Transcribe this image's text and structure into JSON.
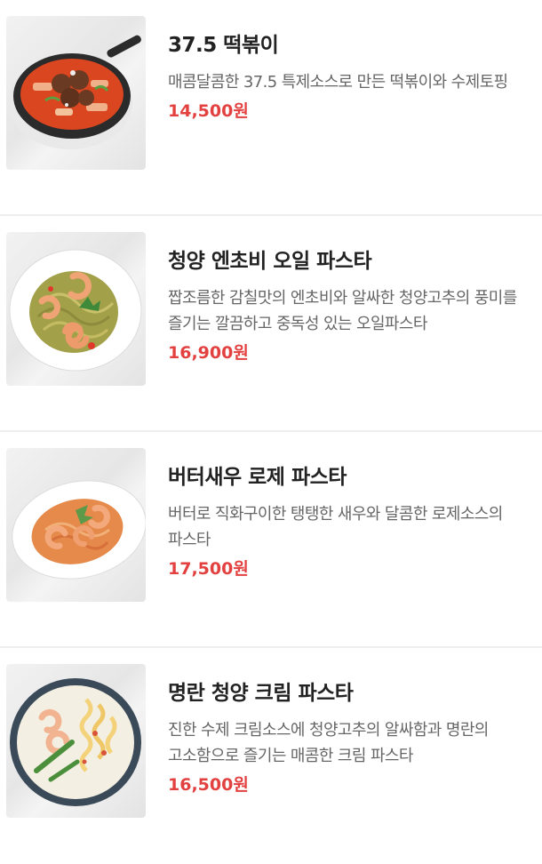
{
  "menu": {
    "items": [
      {
        "name": "37.5 떡볶이",
        "description": "매콤달콤한 37.5 특제소스로 만든 떡볶이와 수제토핑",
        "price": "14,500원",
        "image_icon": "tteokbokki-photo"
      },
      {
        "name": "청양 엔초비 오일 파스타",
        "description": "짭조름한 감칠맛의 엔초비와 알싸한 청양고추의 풍미를 즐기는 깔끔하고 중독성 있는 오일파스타",
        "price": "16,900원",
        "image_icon": "anchovy-oil-pasta-photo"
      },
      {
        "name": "버터새우 로제 파스타",
        "description": "버터로 직화구이한 탱탱한 새우와 달콤한 로제소스의 파스타",
        "price": "17,500원",
        "image_icon": "butter-shrimp-rose-pasta-photo"
      },
      {
        "name": "명란 청양 크림 파스타",
        "description": "진한 수제 크림소스에 청양고추의 알싸함과 명란의 고소함으로 즐기는 매콤한 크림 파스타",
        "price": "16,500원",
        "image_icon": "mentaiko-cream-pasta-photo"
      }
    ]
  },
  "colors": {
    "price": "#e34040",
    "title": "#222222",
    "description": "#666666",
    "divider": "#eeeeee"
  }
}
